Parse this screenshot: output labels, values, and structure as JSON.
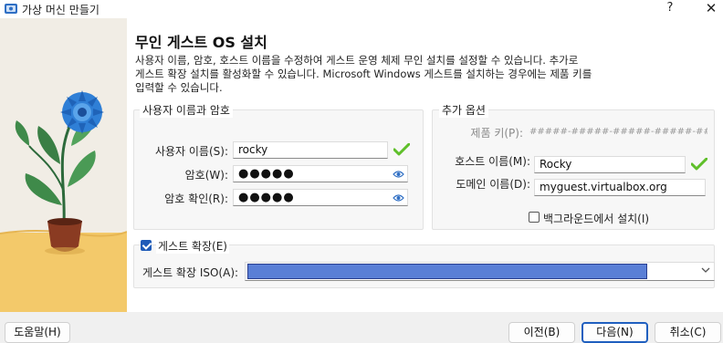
{
  "window": {
    "title": "가상 머신 만들기",
    "help": "?",
    "close": "✕"
  },
  "page": {
    "heading": "무인 게스트 OS 설치",
    "description": "사용자 이름, 암호, 호스트 이름을 수정하여 게스트 운영 체제 무인 설치를 설정할 수 있습니다. 추가로\n게스트 확장 설치를 활성화할 수 있습니다. Microsoft Windows 게스트를 설치하는 경우에는 제품 키를\n입력할 수 있습니다."
  },
  "user_group": {
    "title": "사용자 이름과 암호",
    "username_label": "사용자 이름(S):",
    "username_value": "rocky",
    "password_label": "암호(W):",
    "password_value": "●●●●●",
    "confirm_label": "암호 확인(R):",
    "confirm_value": "●●●●●"
  },
  "extra_group": {
    "title": "추가 옵션",
    "product_key_label": "제품 키(P):",
    "product_key_placeholder": "#####-#####-#####-#####-#####",
    "hostname_label": "호스트 이름(M):",
    "hostname_value": "Rocky",
    "domain_label": "도메인 이름(D):",
    "domain_value": "myguest.virtualbox.org",
    "background_label": "백그라운드에서 설치(I)",
    "background_checked": false
  },
  "guest_additions": {
    "checkbox_label": "게스트 확장(E)",
    "checked": true,
    "iso_label": "게스트 확장 ISO(A):",
    "iso_value": ""
  },
  "footer": {
    "help": "도움말(H)",
    "back": "이전(B)",
    "next": "다음(N)",
    "cancel": "취소(C)"
  },
  "colors": {
    "accent": "#1f5fbf",
    "valid_check": "#5fbf2a",
    "iso_selection": "#5a7fd6"
  }
}
